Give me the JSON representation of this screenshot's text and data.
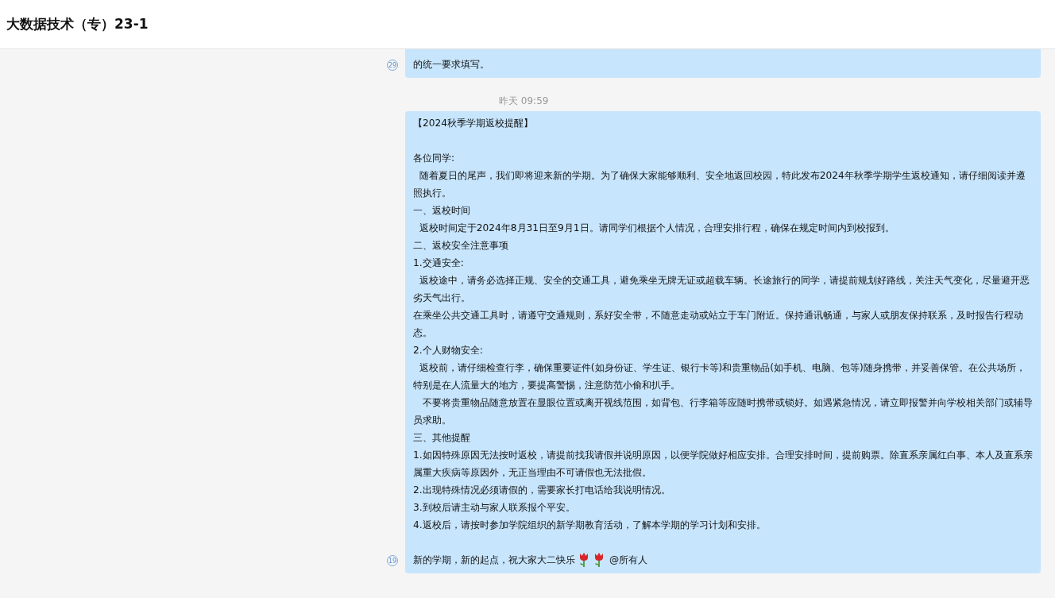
{
  "header": {
    "title": "大数据技术（专）23-1"
  },
  "messages": [
    {
      "read_count": "29",
      "blocks": [
        [
          "的统一要求填写。"
        ]
      ]
    },
    {
      "time": "昨天 09:59",
      "read_count": "19",
      "blocks": [
        [
          "【2024秋季学期返校提醒】"
        ],
        [
          "各位同学:",
          "  随着夏日的尾声，我们即将迎来新的学期。为了确保大家能够顺利、安全地返回校园，特此发布2024年秋季学期学生返校通知，请仔细阅读并遵照执行。",
          "一、返校时间",
          "  返校时间定于2024年8月31日至9月1日。请同学们根据个人情况，合理安排行程，确保在规定时间内到校报到。",
          "二、返校安全注意事项",
          "1.交通安全:",
          "  返校途中，请务必选择正规、安全的交通工具，避免乘坐无牌无证或超载车辆。长途旅行的同学，请提前规划好路线，关注天气变化，尽量避开恶劣天气出行。",
          "在乘坐公共交通工具时，请遵守交通规则，系好安全带，不随意走动或站立于车门附近。保持通讯畅通，与家人或朋友保持联系，及时报告行程动态。",
          "2.个人财物安全:",
          "  返校前，请仔细检查行李，确保重要证件(如身份证、学生证、银行卡等)和贵重物品(如手机、电脑、包等)随身携带，并妥善保管。在公共场所，特别是在人流量大的地方，要提高警惕，注意防范小偷和扒手。",
          "   不要将贵重物品随意放置在显眼位置或离开视线范围，如背包、行李箱等应随时携带或锁好。如遇紧急情况，请立即报警并向学校相关部门或辅导员求助。",
          "三、其他提醒",
          "1.如因特殊原因无法按时返校，请提前找我请假并说明原因，以便学院做好相应安排。合理安排时间，提前购票。除直系亲属红白事、本人及直系亲属重大疾病等原因外，无正当理由不可请假也无法批假。",
          "2.出现特殊情况必须请假的，需要家长打电话给我说明情况。",
          "3.到校后请主动与家人联系报个平安。",
          "4.返校后，请按时参加学院组织的新学期教育活动，了解本学期的学习计划和安排。"
        ]
      ],
      "closing": {
        "text": "新的学期，新的起点，祝大家大二快乐",
        "mention": "@所有人"
      }
    }
  ]
}
